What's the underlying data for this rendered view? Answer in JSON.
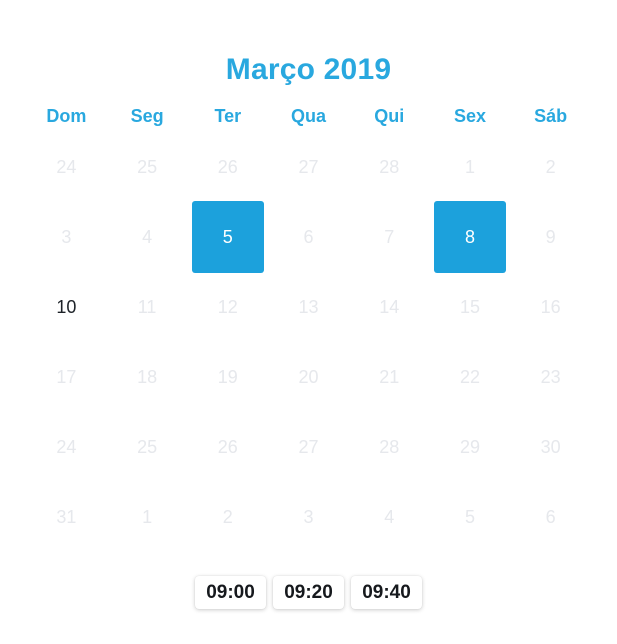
{
  "calendar": {
    "title": "Março 2019",
    "locale_weekdays": [
      "Dom",
      "Seg",
      "Ter",
      "Qua",
      "Qui",
      "Sex",
      "Sáb"
    ],
    "accent_color": "#29a8df",
    "selected_color": "#1ca1dc",
    "disabled_color": "#e6e8ec",
    "today_color": "#1d2228",
    "weeks": [
      [
        {
          "label": "24",
          "state": "disabled"
        },
        {
          "label": "25",
          "state": "disabled"
        },
        {
          "label": "26",
          "state": "disabled"
        },
        {
          "label": "27",
          "state": "disabled"
        },
        {
          "label": "28",
          "state": "disabled"
        },
        {
          "label": "1",
          "state": "disabled"
        },
        {
          "label": "2",
          "state": "disabled"
        }
      ],
      [
        {
          "label": "3",
          "state": "disabled"
        },
        {
          "label": "4",
          "state": "disabled"
        },
        {
          "label": "5",
          "state": "selected"
        },
        {
          "label": "6",
          "state": "disabled"
        },
        {
          "label": "7",
          "state": "disabled"
        },
        {
          "label": "8",
          "state": "selected"
        },
        {
          "label": "9",
          "state": "disabled"
        }
      ],
      [
        {
          "label": "10",
          "state": "today"
        },
        {
          "label": "11",
          "state": "disabled"
        },
        {
          "label": "12",
          "state": "disabled"
        },
        {
          "label": "13",
          "state": "disabled"
        },
        {
          "label": "14",
          "state": "disabled"
        },
        {
          "label": "15",
          "state": "disabled"
        },
        {
          "label": "16",
          "state": "disabled"
        }
      ],
      [
        {
          "label": "17",
          "state": "disabled"
        },
        {
          "label": "18",
          "state": "disabled"
        },
        {
          "label": "19",
          "state": "disabled"
        },
        {
          "label": "20",
          "state": "disabled"
        },
        {
          "label": "21",
          "state": "disabled"
        },
        {
          "label": "22",
          "state": "disabled"
        },
        {
          "label": "23",
          "state": "disabled"
        }
      ],
      [
        {
          "label": "24",
          "state": "disabled"
        },
        {
          "label": "25",
          "state": "disabled"
        },
        {
          "label": "26",
          "state": "disabled"
        },
        {
          "label": "27",
          "state": "disabled"
        },
        {
          "label": "28",
          "state": "disabled"
        },
        {
          "label": "29",
          "state": "disabled"
        },
        {
          "label": "30",
          "state": "disabled"
        }
      ],
      [
        {
          "label": "31",
          "state": "disabled"
        },
        {
          "label": "1",
          "state": "disabled"
        },
        {
          "label": "2",
          "state": "disabled"
        },
        {
          "label": "3",
          "state": "disabled"
        },
        {
          "label": "4",
          "state": "disabled"
        },
        {
          "label": "5",
          "state": "disabled"
        },
        {
          "label": "6",
          "state": "disabled"
        }
      ]
    ]
  },
  "time_slots": [
    {
      "label": "09:00"
    },
    {
      "label": "09:20"
    },
    {
      "label": "09:40"
    }
  ]
}
